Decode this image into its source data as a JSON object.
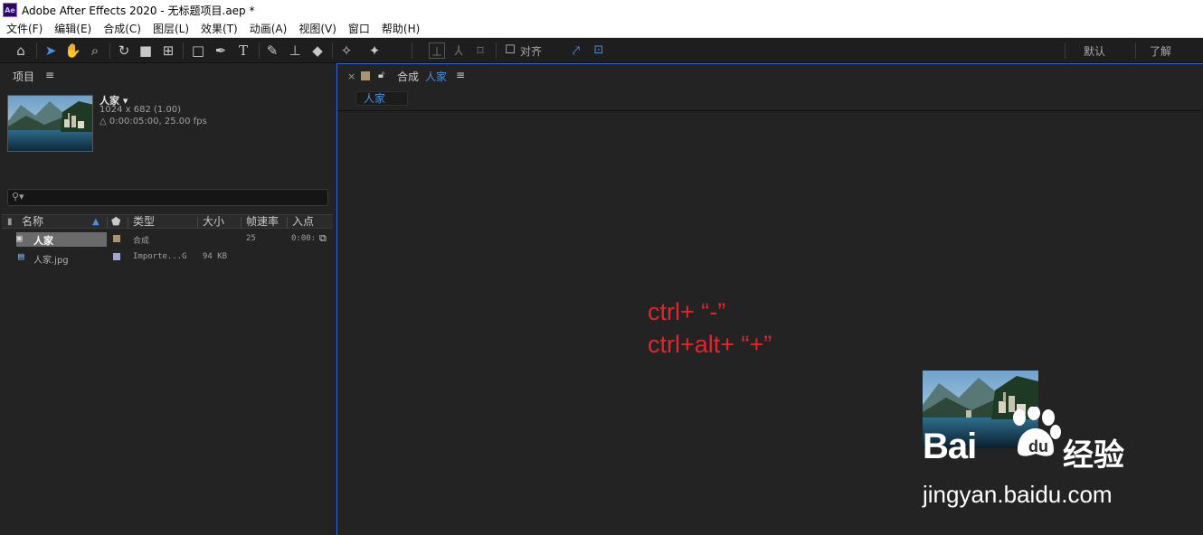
{
  "window": {
    "title": "Adobe After Effects 2020 - 无标题项目.aep *",
    "logo_text": "Ae"
  },
  "menu": [
    "文件(F)",
    "编辑(E)",
    "合成(C)",
    "图层(L)",
    "效果(T)",
    "动画(A)",
    "视图(V)",
    "窗口",
    "帮助(H)"
  ],
  "toolbar": {
    "snap_label": "对齐",
    "workspace_default": "默认",
    "workspace_learn": "了解"
  },
  "project_panel": {
    "tab_title": "项目",
    "tab_menu": "≡",
    "selected": {
      "name": "人家",
      "dimensions": "1024 x 682 (1.00)",
      "duration": "△ 0:00:05:00, 25.00 fps"
    },
    "search_placeholder": "",
    "columns": {
      "name": "名称",
      "type": "类型",
      "size": "大小",
      "framerate": "帧速率",
      "in_point": "入点"
    },
    "rows": [
      {
        "name": "人家",
        "type": "合成",
        "size": "",
        "framerate": "25",
        "in_point": "0:00:",
        "label_color": "#a89470"
      },
      {
        "name": "人家.jpg",
        "type": "Importe...G",
        "size": "94 KB",
        "framerate": "",
        "in_point": "",
        "label_color": "#a3a3d6"
      }
    ]
  },
  "viewer": {
    "close": "×",
    "tab_prefix": "合成",
    "tab_name": "人家",
    "tab_menu": "≡",
    "breadcrumb": "人家",
    "annotation_line1": "ctrl+ “-”",
    "annotation_line2": "ctrl+alt+ “+”"
  },
  "watermark": {
    "brand": "Bai du",
    "product": "经验",
    "url": "jingyan.baidu.com"
  },
  "colors": {
    "accent_blue": "#4a90e2",
    "annotation_red": "#e2242c",
    "panel_bg": "#232323"
  }
}
